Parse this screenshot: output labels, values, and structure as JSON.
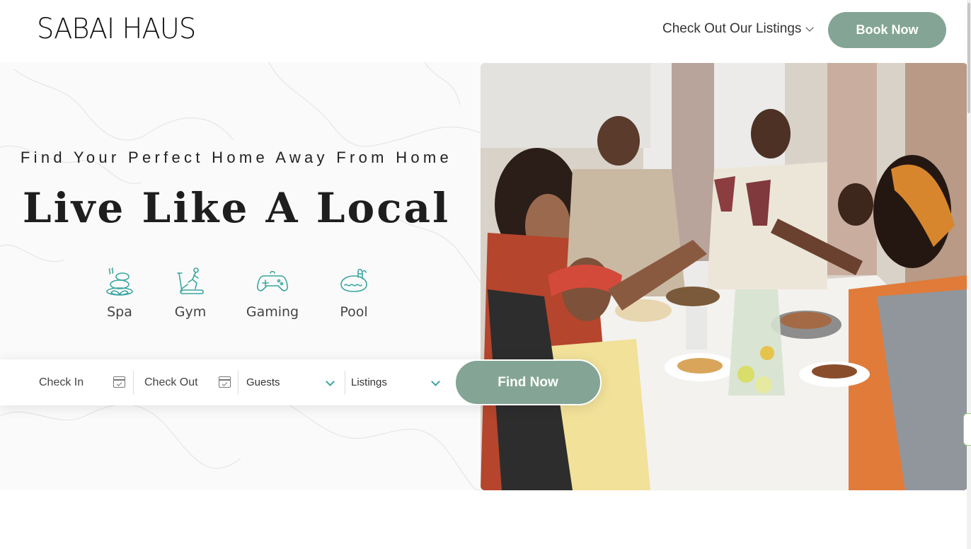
{
  "header": {
    "logo": "SABAI HAUS",
    "nav_listings": "Check Out Our Listings",
    "book_button": "Book Now"
  },
  "hero": {
    "tagline": "Find Your Perfect Home Away From Home",
    "headline": "Live Like A Local",
    "amenities": [
      {
        "label": "Spa",
        "icon": "spa-stones-icon"
      },
      {
        "label": "Gym",
        "icon": "treadmill-icon"
      },
      {
        "label": "Gaming",
        "icon": "gamepad-icon"
      },
      {
        "label": "Pool",
        "icon": "pool-icon"
      }
    ]
  },
  "search": {
    "check_in": "Check In",
    "check_out": "Check Out",
    "guests": "Guests",
    "listings": "Listings",
    "find_button": "Find Now"
  },
  "colors": {
    "accent": "#84a595",
    "icon_teal": "#3aa6a0",
    "text_dark": "#1e1e1e"
  }
}
